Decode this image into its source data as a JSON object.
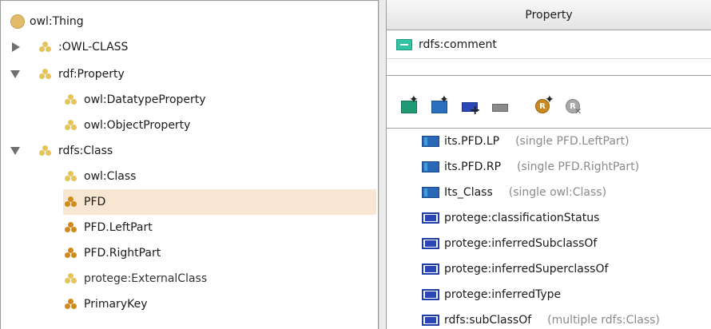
{
  "tree": {
    "items": [
      {
        "label": "owl:Thing",
        "icon": "thing-icon",
        "toggle": "none"
      },
      {
        "label": ":OWL-CLASS",
        "icon": "class-icon",
        "toggle": "collapsed"
      },
      {
        "label": "rdf:Property",
        "icon": "class-icon",
        "toggle": "expanded"
      },
      {
        "label": "owl:DatatypeProperty",
        "icon": "class-icon",
        "toggle": "none"
      },
      {
        "label": "owl:ObjectProperty",
        "icon": "class-icon",
        "toggle": "none"
      },
      {
        "label": "rdfs:Class",
        "icon": "class-icon",
        "toggle": "expanded"
      },
      {
        "label": "owl:Class",
        "icon": "class-icon",
        "toggle": "none"
      },
      {
        "label": "PFD",
        "icon": "class-icon",
        "toggle": "none",
        "selected": true
      },
      {
        "label": "PFD.LeftPart",
        "icon": "class-icon",
        "toggle": "none"
      },
      {
        "label": "PFD.RightPart",
        "icon": "class-icon",
        "toggle": "none"
      },
      {
        "label": "protege:ExternalClass",
        "icon": "class-icon",
        "toggle": "none"
      },
      {
        "label": "PrimaryKey",
        "icon": "class-icon",
        "toggle": "none"
      }
    ]
  },
  "properties": {
    "header": "Property",
    "rows": [
      {
        "label": "rdfs:comment",
        "icon": "annotation-property-icon"
      }
    ]
  },
  "toolbar": {
    "buttons": [
      {
        "name": "create-slot-button",
        "icon": "new-slot-icon"
      },
      {
        "name": "create-slot-alt-button",
        "icon": "new-slot-icon"
      },
      {
        "name": "add-slot-button",
        "icon": "add-slot-icon"
      },
      {
        "name": "remove-slot-button",
        "icon": "remove-slot-icon"
      },
      {
        "name": "create-restriction-button",
        "icon": "restriction-icon"
      },
      {
        "name": "remove-restriction-button",
        "icon": "remove-restriction-icon"
      }
    ]
  },
  "slots": [
    {
      "label": "its.PFD.LP",
      "note": "(single PFD.LeftPart)",
      "kind": "own"
    },
    {
      "label": "its.PFD.RP",
      "note": "(single PFD.RightPart)",
      "kind": "own"
    },
    {
      "label": "Its_Class",
      "note": "(single owl:Class)",
      "kind": "own"
    },
    {
      "label": "protege:classificationStatus",
      "note": "",
      "kind": "inherited"
    },
    {
      "label": "protege:inferredSubclassOf",
      "note": "",
      "kind": "inherited"
    },
    {
      "label": "protege:inferredSuperclassOf",
      "note": "",
      "kind": "inherited"
    },
    {
      "label": "protege:inferredType",
      "note": "",
      "kind": "inherited"
    },
    {
      "label": "rdfs:subClassOf",
      "note": "(multiple rdfs:Class)",
      "kind": "inherited"
    }
  ],
  "colors": {
    "selection": "#f6e6d2",
    "thing": "#e2bb6a",
    "class_dots_light": "#e6c45c",
    "class_dots_dark": "#d08a1a",
    "annotation": "#2fc3a4",
    "slot_own": "#2b67b6",
    "slot_inherited": "#1f3fa6"
  }
}
